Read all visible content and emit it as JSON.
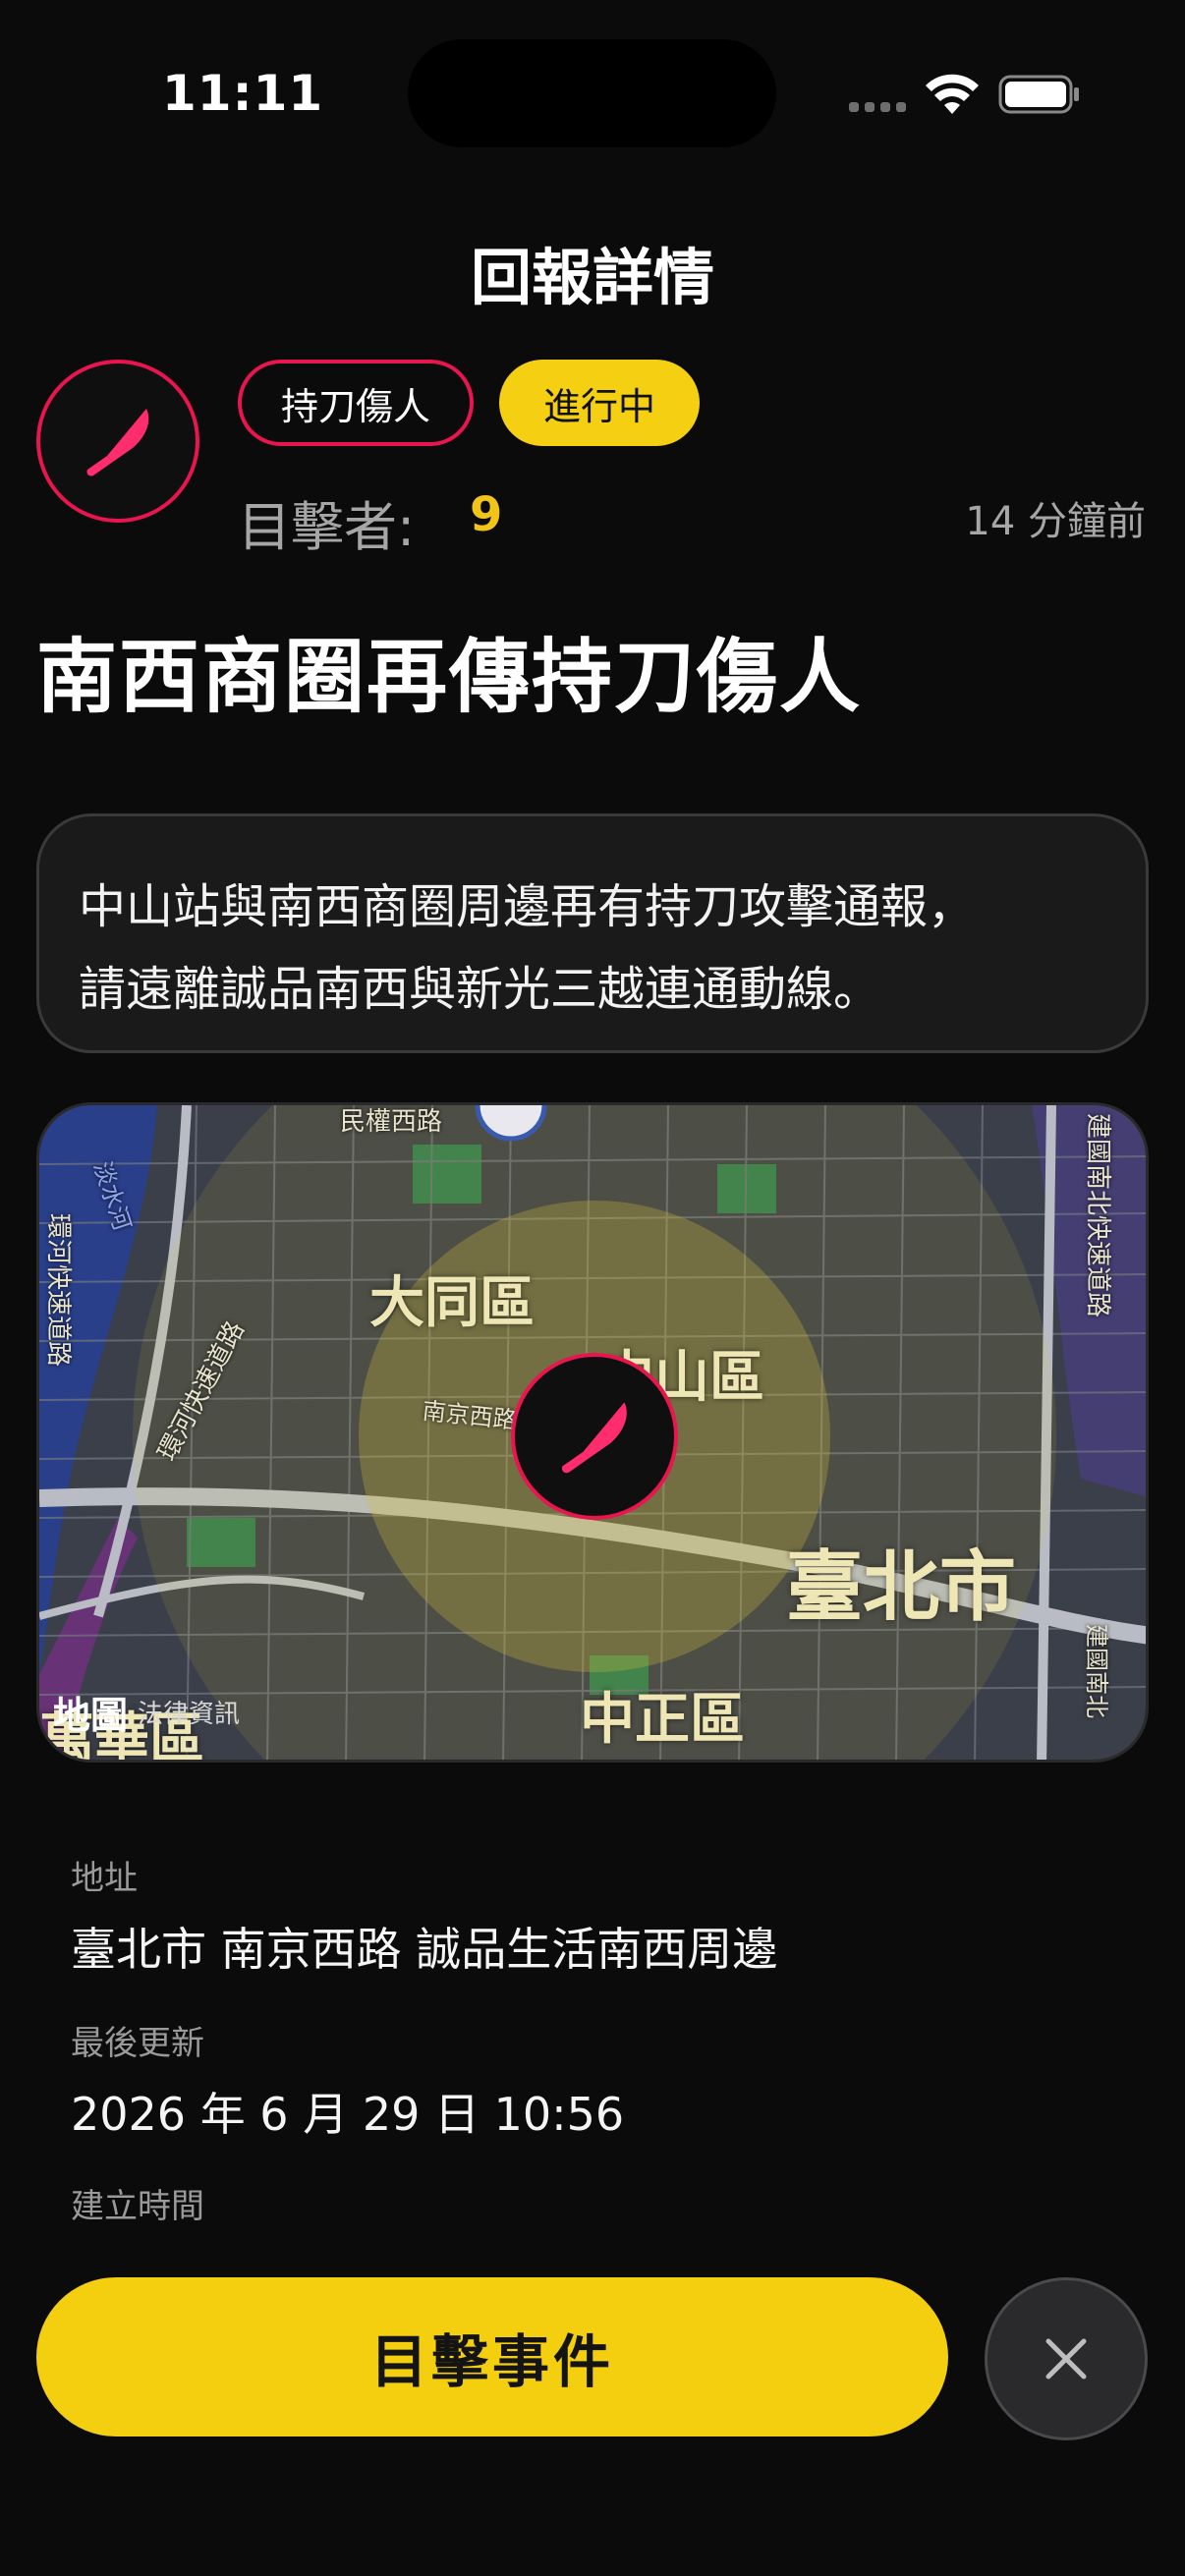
{
  "status_bar": {
    "time": "11:11"
  },
  "nav": {
    "title": "回報詳情"
  },
  "report": {
    "category": "持刀傷人",
    "status": "進行中",
    "witness_label": "目擊者:",
    "witness_count": "9",
    "time_ago": "14 分鐘前",
    "title": "南西商圈再傳持刀傷人",
    "description_lines": [
      "中山站與南西商圈周邊再有持刀攻擊通報，",
      "請遠離誠品南西與新光三越連通動線。"
    ]
  },
  "map": {
    "district_labels": [
      "大同區",
      "中山區",
      "臺北市",
      "中正區",
      "萬華區"
    ],
    "road_labels": [
      "環河快速道路",
      "建國南北快速道路",
      "南京西路",
      "環河快速道路",
      "建國南北",
      "民權西路"
    ],
    "river_label": "淡水河",
    "legal_brand": "地圖",
    "legal_text": "法律資訊",
    "colors": {
      "zone": "#d6c33a",
      "pin_border": "#e8154f"
    }
  },
  "info": [
    {
      "label": "地址",
      "value": "臺北市 南京西路 誠品生活南西周邊"
    },
    {
      "label": "最後更新",
      "value": "2026 年 6 月 29 日 10:56"
    },
    {
      "label": "建立時間",
      "value": ""
    }
  ],
  "actions": {
    "witness_button": "目擊事件"
  },
  "icons": {
    "category": "knife-icon",
    "close": "close-icon"
  }
}
